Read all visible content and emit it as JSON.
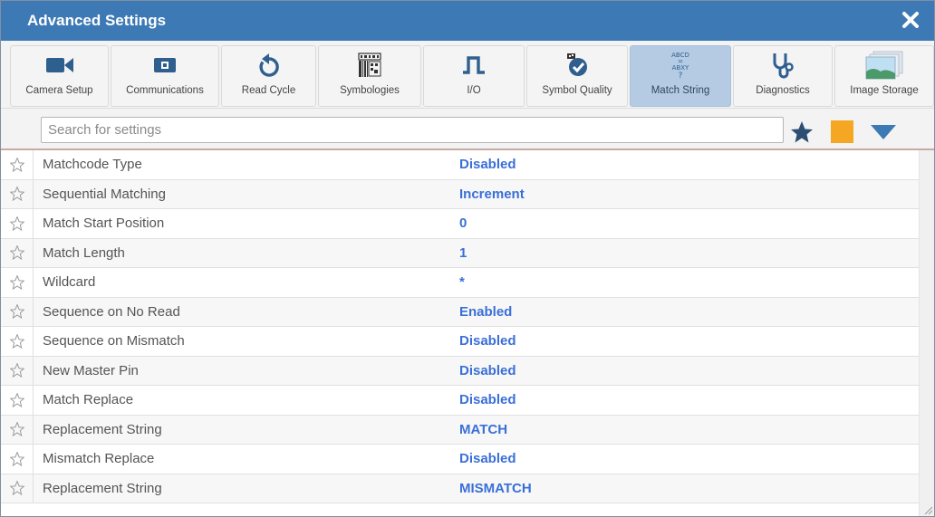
{
  "window": {
    "title": "Advanced Settings",
    "close_icon": "close-x-icon"
  },
  "toolbar": {
    "tabs": [
      {
        "label": "Camera Setup",
        "icon": "video-camera-icon"
      },
      {
        "label": "Communications",
        "icon": "port-connector-icon"
      },
      {
        "label": "Read Cycle",
        "icon": "refresh-icon"
      },
      {
        "label": "Symbologies",
        "icon": "barcode-icon"
      },
      {
        "label": "I/O",
        "icon": "pulse-signal-icon"
      },
      {
        "label": "Symbol Quality",
        "icon": "badge-check-icon"
      },
      {
        "label": "Match String",
        "icon": "match-string-icon",
        "active": true
      },
      {
        "label": "Diagnostics",
        "icon": "stethoscope-icon"
      },
      {
        "label": "Image Storage",
        "icon": "image-stack-icon"
      }
    ],
    "active_color": "#b4cbe3"
  },
  "search": {
    "placeholder": "Search for settings",
    "value": ""
  },
  "colors": {
    "titlebar": "#3d79b4",
    "value_text": "#3a6fd8",
    "orange_button": "#f5a623",
    "icon_blue": "#2f5f8f"
  },
  "settings": [
    {
      "label": "Matchcode Type",
      "value": "Disabled"
    },
    {
      "label": "Sequential Matching",
      "value": "Increment"
    },
    {
      "label": "Match Start Position",
      "value": "0"
    },
    {
      "label": "Match Length",
      "value": "1"
    },
    {
      "label": "Wildcard",
      "value": "*"
    },
    {
      "label": "Sequence on No Read",
      "value": "Enabled"
    },
    {
      "label": "Sequence on Mismatch",
      "value": "Disabled"
    },
    {
      "label": "New Master Pin",
      "value": "Disabled"
    },
    {
      "label": "Match Replace",
      "value": "Disabled"
    },
    {
      "label": "Replacement String",
      "value": "MATCH"
    },
    {
      "label": "Mismatch Replace",
      "value": "Disabled"
    },
    {
      "label": "Replacement String",
      "value": "MISMATCH"
    }
  ]
}
